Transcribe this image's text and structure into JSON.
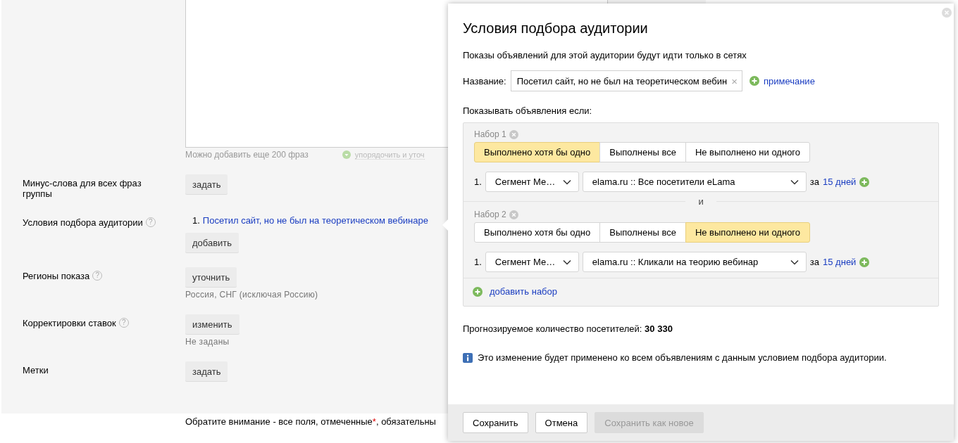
{
  "form": {
    "textarea_hint": "Можно добавить еще 200 фраз",
    "sort_link": "упорядочить и уточ",
    "rows": [
      {
        "label": "Минус-слова для всех фраз группы",
        "button": "задать"
      },
      {
        "label": "Условия подбора аудитории",
        "help": "?",
        "items": [
          {
            "number": "1.",
            "link": "Посетил сайт, но не был на теоретическом вебинаре"
          }
        ],
        "button": "добавить"
      },
      {
        "label": "Регионы показа",
        "help": "?",
        "button": "уточнить",
        "note": "Россия, СНГ (исключая Россию)"
      },
      {
        "label": "Корректировки ставок",
        "help": "?",
        "button": "изменить",
        "note": "Не заданы"
      },
      {
        "label": "Метки",
        "button": "задать"
      }
    ],
    "footer_note": {
      "before": "Обратите внимание - все поля, отмеченные",
      "asterisk": "*",
      "after": ", обязательны"
    }
  },
  "dialog": {
    "title": "Условия подбора аудитории",
    "subtitle": "Показы объявлений для этой аудитории будут идти только в сетях",
    "name_label": "Название:",
    "name_value": "Посетил сайт, но не был на теоретическом вебин",
    "clear": "×",
    "note_link": "примечание",
    "conditions_label": "Показывать объявления если:",
    "sets": [
      {
        "title": "Набор 1",
        "modes": [
          {
            "label": "Выполнено хотя бы одно",
            "selected": true
          },
          {
            "label": "Выполнены все",
            "selected": false
          },
          {
            "label": "Не выполнено ни одного",
            "selected": false
          }
        ],
        "rules": [
          {
            "number": "1.",
            "type": "Сегмент Ме…",
            "segment": "elama.ru :: Все посетители eLama",
            "period_prefix": "за",
            "period": "15 дней"
          }
        ]
      },
      {
        "title": "Набор 2",
        "modes": [
          {
            "label": "Выполнено хотя бы одно",
            "selected": false
          },
          {
            "label": "Выполнены все",
            "selected": false
          },
          {
            "label": "Не выполнено ни одного",
            "selected": true
          }
        ],
        "rules": [
          {
            "number": "1.",
            "type": "Сегмент Ме…",
            "segment": "elama.ru :: Кликали на теорию вебинар",
            "period_prefix": "за",
            "period": "15 дней"
          }
        ]
      }
    ],
    "separator": "и",
    "add_set": "добавить набор",
    "forecast_label": "Прогнозируемое количество посетителей:",
    "forecast_value": "30 330",
    "info": "Это изменение будет применено ко всем объявлениям с данным условием подбора аудитории.",
    "buttons": [
      {
        "label": "Сохранить",
        "disabled": false
      },
      {
        "label": "Отмена",
        "disabled": false
      },
      {
        "label": "Сохранить как новое",
        "disabled": true
      }
    ]
  }
}
